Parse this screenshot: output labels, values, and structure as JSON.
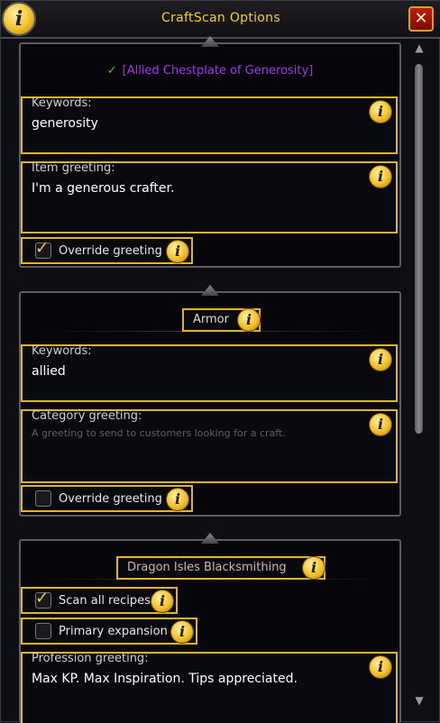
{
  "window": {
    "title": "CraftScan Options",
    "info_glyph": "i",
    "close_glyph": "✕"
  },
  "icons": {
    "info": "i",
    "check": "✓",
    "scroll_up": "▲",
    "scroll_down": "▼"
  },
  "item_section": {
    "item_link": "[Allied Chestplate of Generosity]",
    "keywords_label": "Keywords:",
    "keywords_value": "generosity",
    "greeting_label": "Item greeting:",
    "greeting_value": "I'm a generous crafter.",
    "override_label": "Override greeting",
    "override_checked": true
  },
  "category_section": {
    "header": "Armor",
    "keywords_label": "Keywords:",
    "keywords_value": "allied",
    "greeting_label": "Category greeting:",
    "greeting_placeholder": "A greeting to send to customers looking for a craft.",
    "override_label": "Override greeting",
    "override_checked": false
  },
  "profession_section": {
    "header": "Dragon Isles Blacksmithing",
    "scan_all_label": "Scan all recipes",
    "scan_all_checked": true,
    "primary_label": "Primary expansion",
    "primary_checked": false,
    "greeting_label": "Profession greeting:",
    "greeting_value": "Max KP. Max Inspiration. Tips appreciated."
  },
  "colors": {
    "title": "#f0cf30",
    "highlight_border": "#e0b52c",
    "epic_item": "#a335ee",
    "close_button": "#c51b0d"
  }
}
